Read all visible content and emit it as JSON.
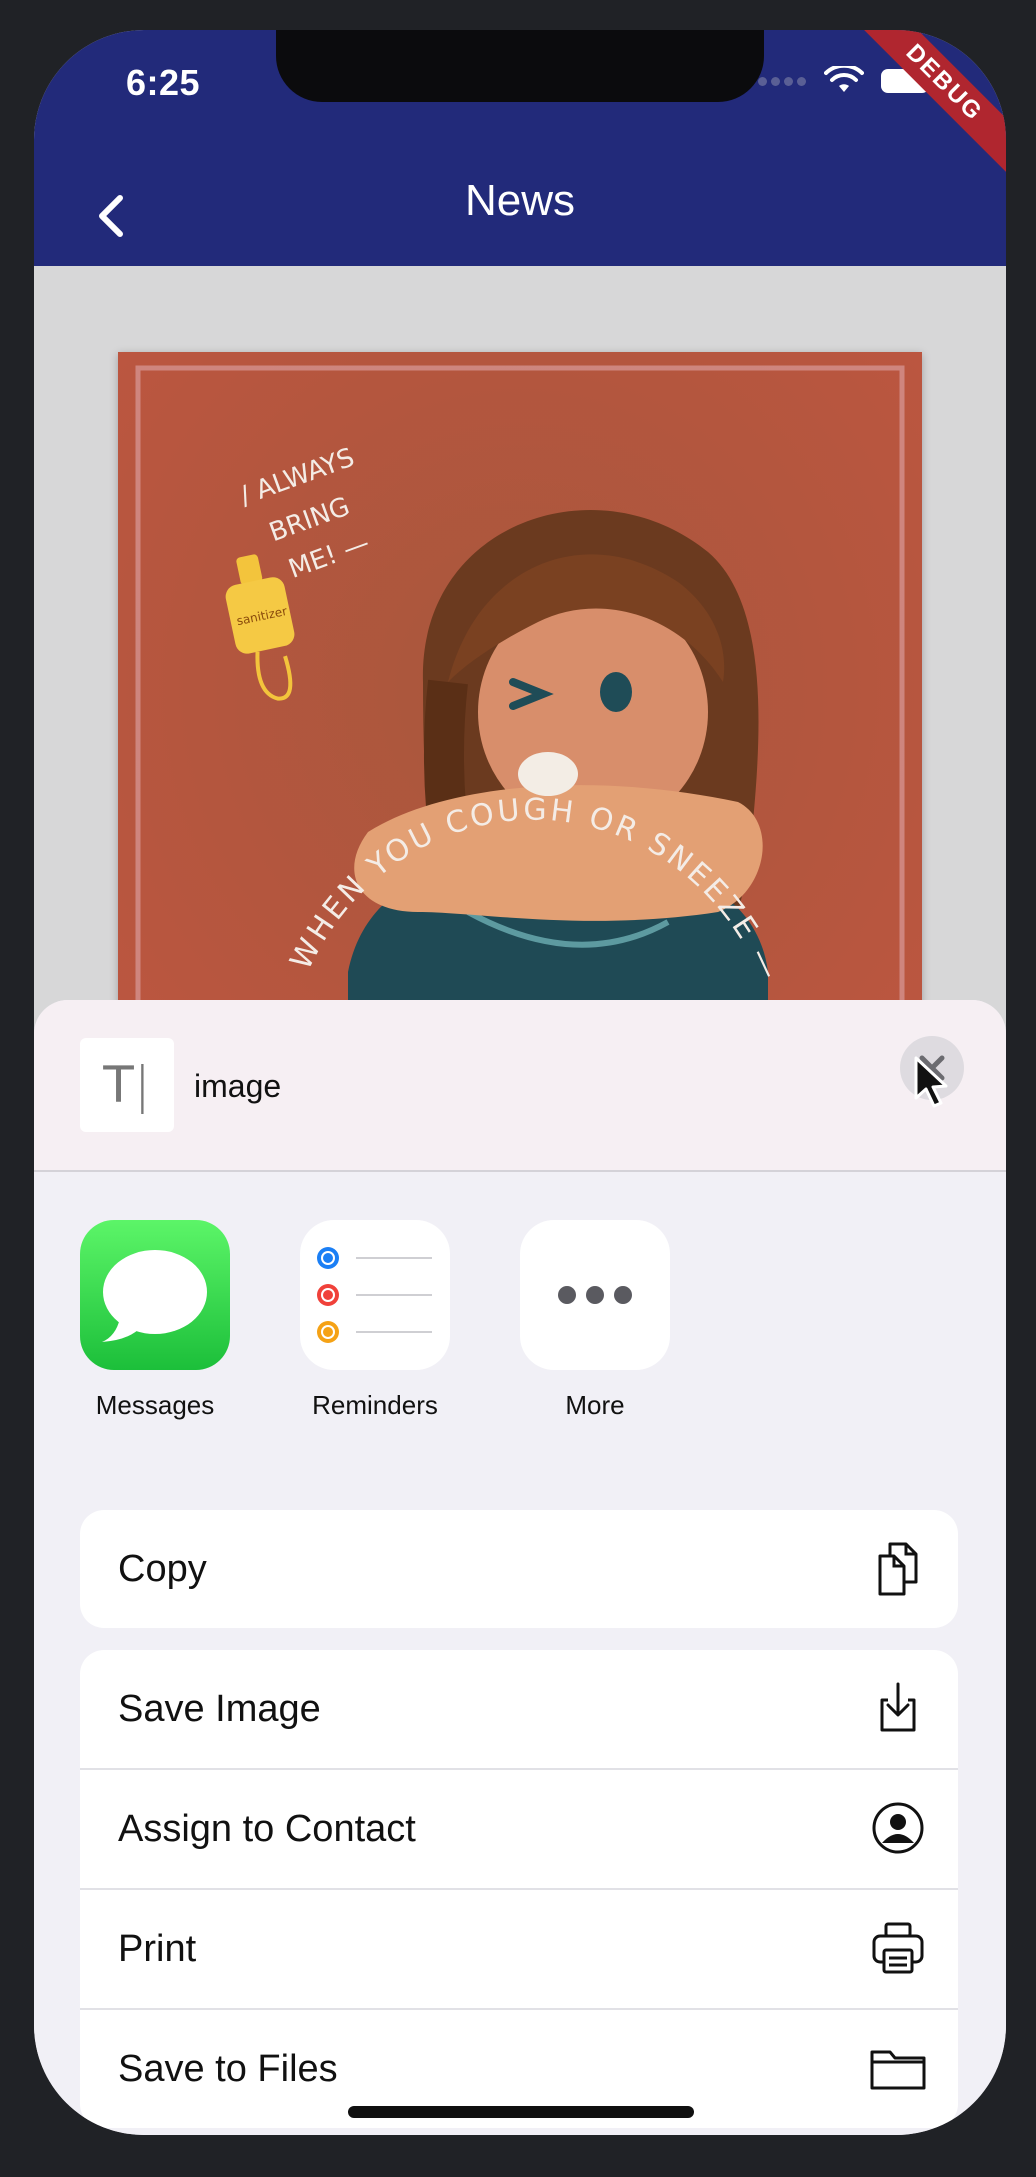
{
  "status_bar": {
    "time": "6:25",
    "debug_banner": "DEBUG"
  },
  "app_bar": {
    "title": "News",
    "back_icon": "chevron-left-icon"
  },
  "poster": {
    "image_description_icon": "illustration-image",
    "lettering": "WHEN YOU COUGH OR SNEEZE — COVER YOUR MOUTH WITH YOUR ELBOW",
    "note": "/ ALWAYS BRING ME! —",
    "bottle_label": "sanitizer"
  },
  "share_sheet": {
    "header": {
      "name": "image",
      "thumb_glyph": "T",
      "close_icon": "close-icon"
    },
    "apps": [
      {
        "label": "Messages",
        "icon": "messages-icon"
      },
      {
        "label": "Reminders",
        "icon": "reminders-icon"
      },
      {
        "label": "More",
        "icon": "more-dots-icon"
      }
    ],
    "actions_primary": [
      {
        "label": "Copy",
        "icon": "copy-icon"
      }
    ],
    "actions": [
      {
        "label": "Save Image",
        "icon": "save-image-icon"
      },
      {
        "label": "Assign to Contact",
        "icon": "contact-icon"
      },
      {
        "label": "Print",
        "icon": "printer-icon"
      },
      {
        "label": "Save to Files",
        "icon": "folder-icon"
      }
    ]
  },
  "colors": {
    "app_bar": "#222a7a",
    "poster_bg": "#b5563f",
    "debug": "#b0262f",
    "sheet_bg": "#f1f0f6"
  }
}
